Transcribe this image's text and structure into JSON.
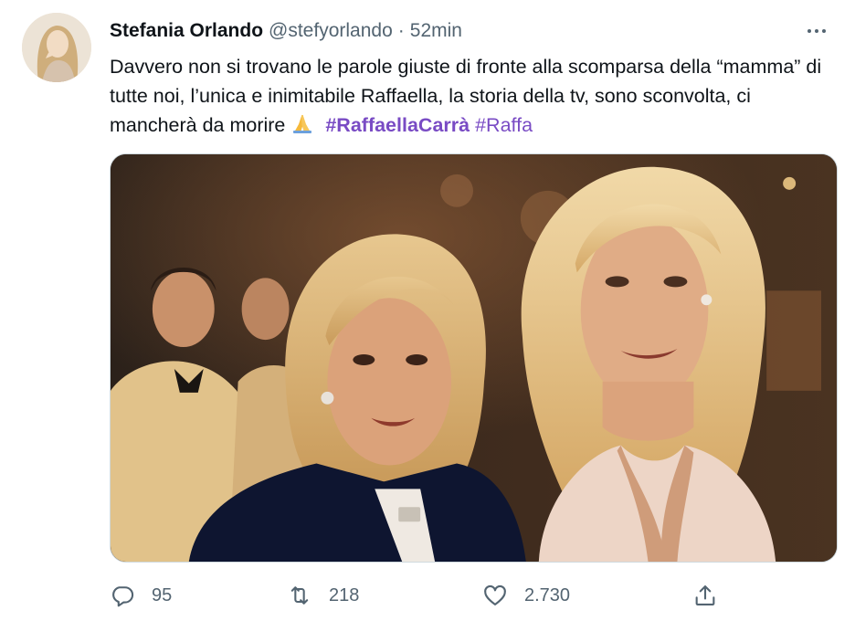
{
  "author": {
    "name": "Stefania Orlando",
    "handle": "@stefyorlando",
    "separator": "·",
    "time": "52min"
  },
  "tweet": {
    "text": "Davvero non si trovano le parole giuste di fronte alla scomparsa della “mamma” di tutte noi, l’unica e inimitabile Raffaella, la storia della tv, sono sconvolta, ci mancherà da morire ",
    "emoji": "folded-hands-icon",
    "hashtag1": "#RaffaellaCarrà",
    "hashtag2": "#Raffa"
  },
  "stats": {
    "replies": "95",
    "retweets": "218",
    "likes": "2.730"
  },
  "icons": {
    "more": "more-icon",
    "reply": "reply-icon",
    "retweet": "retweet-icon",
    "like": "heart-icon",
    "share": "share-icon"
  },
  "colors": {
    "text": "#0f1419",
    "secondary": "#536471",
    "hashtag": "#794bc4",
    "border": "#cfd9de"
  }
}
